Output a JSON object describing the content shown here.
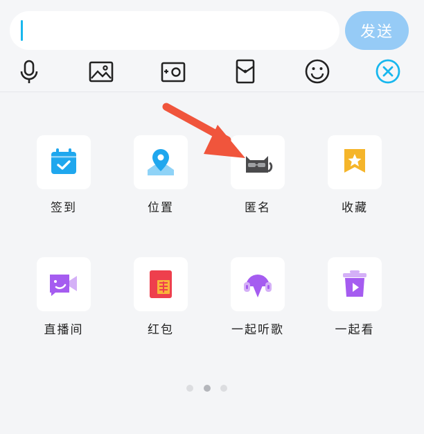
{
  "composer": {
    "input_value": "",
    "send_label": "发送"
  },
  "toolbar": {
    "items": [
      {
        "name": "voice",
        "icon": "microphone-icon"
      },
      {
        "name": "photo",
        "icon": "image-icon"
      },
      {
        "name": "camera",
        "icon": "camera-icon"
      },
      {
        "name": "red-packet",
        "icon": "envelope-icon"
      },
      {
        "name": "emoji",
        "icon": "smiley-icon"
      },
      {
        "name": "close",
        "icon": "close-circle-icon"
      }
    ]
  },
  "features": {
    "items": [
      {
        "label": "签到",
        "icon": "calendar-check-icon",
        "color": "#1fa7ee"
      },
      {
        "label": "位置",
        "icon": "location-pin-icon",
        "color": "#1fa7ee"
      },
      {
        "label": "匿名",
        "icon": "cat-sunglasses-icon",
        "color": "#4a4a4c"
      },
      {
        "label": "收藏",
        "icon": "star-bookmark-icon",
        "color": "#f5b52a"
      },
      {
        "label": "直播间",
        "icon": "live-camera-icon",
        "color": "#a55cf0"
      },
      {
        "label": "红包",
        "icon": "red-packet-icon",
        "color": "#ee3f4d"
      },
      {
        "label": "一起听歌",
        "icon": "headphones-icon",
        "color": "#a55cf0"
      },
      {
        "label": "一起看",
        "icon": "tv-box-icon",
        "color": "#a55cf0"
      }
    ]
  },
  "pager": {
    "total": 3,
    "active": 2
  },
  "colors": {
    "accent": "#18b7ee",
    "send_button": "#96cbf6",
    "annotation_arrow": "#f0553c"
  }
}
